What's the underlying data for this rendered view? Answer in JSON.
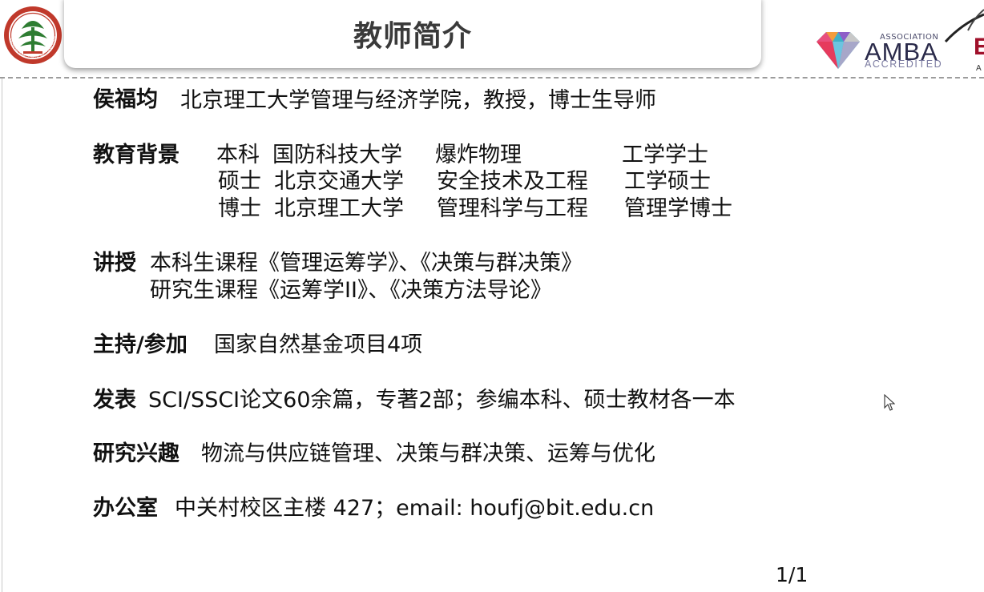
{
  "header": {
    "title": "教师简介",
    "amba": {
      "association": "ASSOCIATION",
      "name": "AMBA",
      "accredited": "ACCREDITED"
    },
    "partner_logo": {
      "letter": "E",
      "small": "A"
    }
  },
  "profile": {
    "name": "侯福均",
    "position": "北京理工大学管理与经济学院，教授，博士生导师",
    "education_label": "教育背景",
    "education": [
      {
        "degree": "本科",
        "school": "国防科技大学",
        "major": "爆炸物理",
        "title": "工学学士"
      },
      {
        "degree": "硕士",
        "school": "北京交通大学",
        "major": "安全技术及工程",
        "title": "工学硕士"
      },
      {
        "degree": "博士",
        "school": "北京理工大学",
        "major": "管理科学与工程",
        "title": "管理学博士"
      }
    ],
    "teaching_label": "讲授",
    "teaching": [
      "本科生课程《管理运筹学》、《决策与群决策》",
      "研究生课程《运筹学II》、《决策方法导论》"
    ],
    "projects_label": "主持/参加",
    "projects": "国家自然基金项目4项",
    "publications_label": "发表",
    "publications": "SCI/SSCI论文60余篇，专著2部；参编本科、硕士教材各一本",
    "interests_label": "研究兴趣",
    "interests": "物流与供应链管理、决策与群决策、运筹与优化",
    "office_label": "办公室",
    "office": "中关村校区主楼 427；email: houfj@bit.edu.cn"
  },
  "footer": {
    "page": "1/1"
  },
  "colors": {
    "seal_red": "#c0392b",
    "seal_green": "#2e7d32",
    "amba_navy": "#2a2a4a",
    "partner_red": "#a0102a"
  }
}
